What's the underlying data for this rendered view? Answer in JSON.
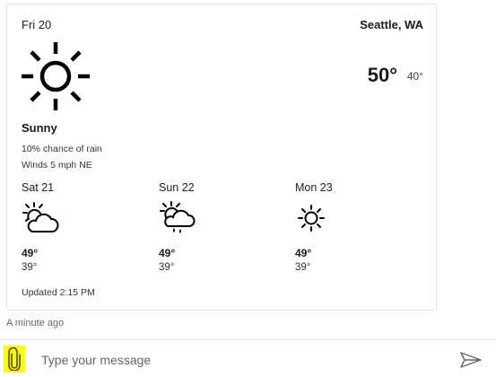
{
  "card": {
    "day": "Fri 20",
    "location": "Seattle, WA",
    "temp_high": "50°",
    "temp_low": "40°",
    "condition": "Sunny",
    "condition_icon": "sun-icon",
    "rain_chance": "10% chance of rain",
    "wind": "Winds 5 mph NE",
    "forecast": [
      {
        "day": "Sat 21",
        "icon": "partly-cloudy-icon",
        "high": "49°",
        "low": "39°"
      },
      {
        "day": "Sun 22",
        "icon": "rain-cloud-icon",
        "high": "49°",
        "low": "39°"
      },
      {
        "day": "Mon 23",
        "icon": "sun-icon",
        "high": "49°",
        "low": "39°"
      }
    ],
    "updated": "Updated 2:15 PM"
  },
  "timestamp": "A minute ago",
  "composer": {
    "placeholder": "Type your message",
    "attach_icon": "paperclip-icon",
    "send_icon": "send-icon",
    "attach_highlight_color": "#ffff00"
  }
}
